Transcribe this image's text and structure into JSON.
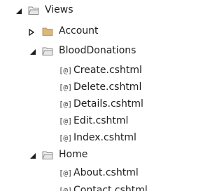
{
  "tree": {
    "views": {
      "label": "Views",
      "expanded": true
    },
    "account": {
      "label": "Account",
      "expanded": false
    },
    "blood_donations": {
      "label": "BloodDonations",
      "expanded": true,
      "files": [
        {
          "name": "Create.cshtml"
        },
        {
          "name": "Delete.cshtml"
        },
        {
          "name": "Details.cshtml"
        },
        {
          "name": "Edit.cshtml"
        },
        {
          "name": "Index.cshtml"
        }
      ]
    },
    "home": {
      "label": "Home",
      "expanded": true,
      "files": [
        {
          "name": "About.cshtml"
        },
        {
          "name": "Contact.cshtml"
        }
      ]
    }
  },
  "icons": {
    "expanded_arrow": "expanded-arrow-icon",
    "collapsed_arrow": "collapsed-arrow-icon",
    "open_folder": "open-folder-icon",
    "closed_folder": "closed-folder-icon",
    "razor_file": "razor-file-icon",
    "razor_file_glyph": "[@]"
  },
  "colors": {
    "arrow": "#1e1e1e",
    "folder_fill": "#dcb67a",
    "folder_stroke": "#8c6d3a",
    "text": "#1e1e1e"
  }
}
